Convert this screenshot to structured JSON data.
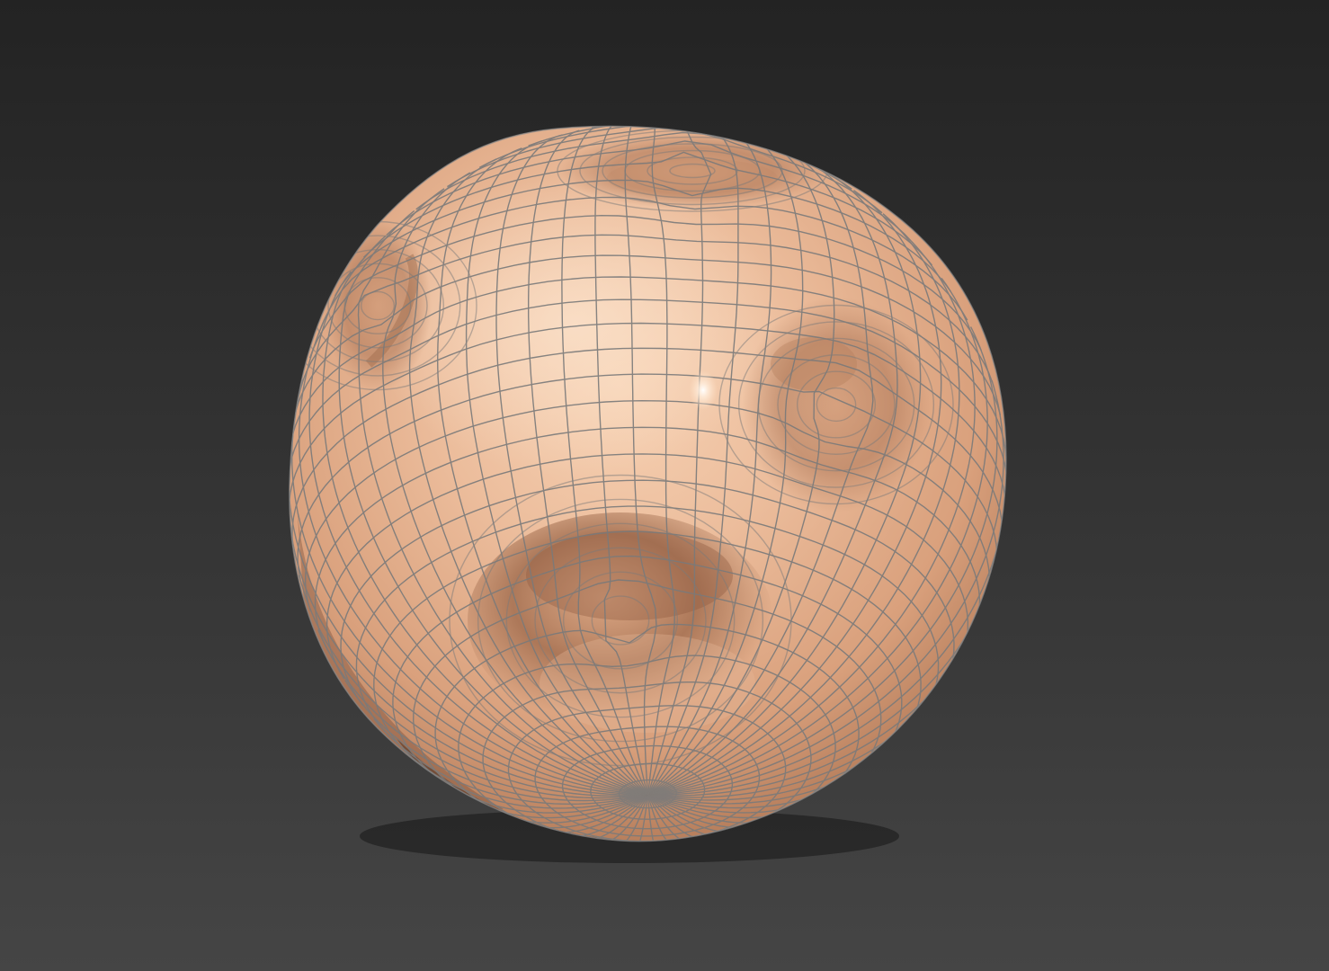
{
  "viewport": {
    "background_top": "#232323",
    "background_bottom": "#454545"
  },
  "model": {
    "object": "sphere-mesh",
    "shading": "smooth",
    "wireframe_overlay": true,
    "material_color": "#e9b18e",
    "highlight_color": "#fff6e8",
    "shadow_color": "#5a3c2c",
    "wire_color": "#7a7a7a",
    "dent_count": 4
  }
}
